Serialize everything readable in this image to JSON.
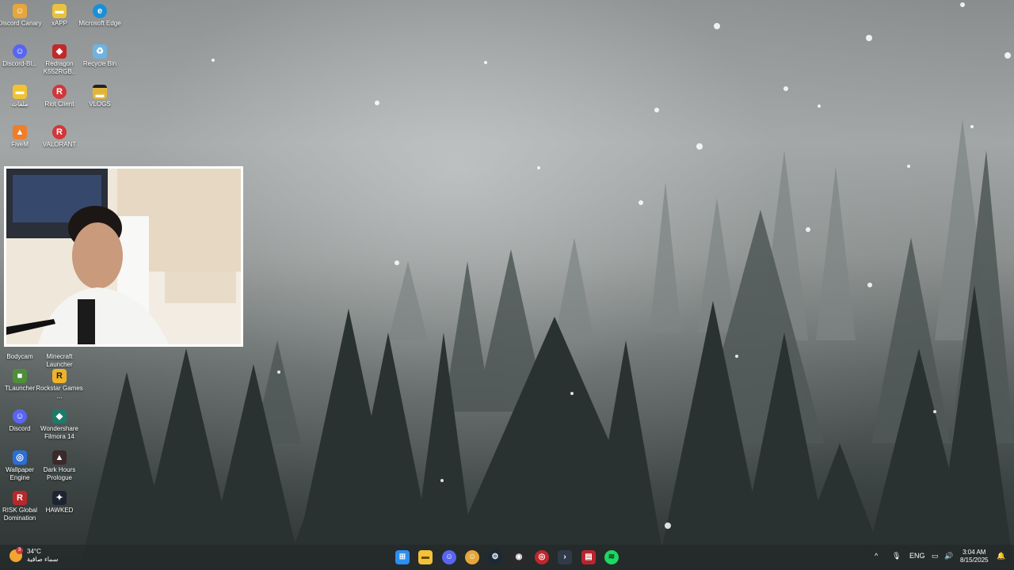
{
  "desktop": {
    "icons": [
      {
        "label": "Discord Canary",
        "icon": "discord-canary-icon",
        "color": "#e6a63a",
        "glyph": "☺"
      },
      {
        "label": "xAPP",
        "icon": "folder-icon",
        "color": "#e9c23d",
        "glyph": "▬"
      },
      {
        "label": "Microsoft Edge",
        "icon": "edge-icon",
        "color": "#1a8fd6",
        "glyph": "e"
      },
      {
        "label": "Discord-Bl...",
        "icon": "discord-icon",
        "color": "#5865f2",
        "glyph": "☺"
      },
      {
        "label": "Redragon K552RGB..",
        "icon": "redragon-icon",
        "color": "#c02a2a",
        "glyph": "◆"
      },
      {
        "label": "Recycle Bin",
        "icon": "recycle-bin-icon",
        "color": "#6fb3e0",
        "glyph": "♻"
      },
      {
        "label": "ملفات",
        "icon": "folder-icon",
        "color": "#f1c232",
        "glyph": "▬"
      },
      {
        "label": "Riot Client",
        "icon": "riot-client-icon",
        "color": "#d1363a",
        "glyph": "R"
      },
      {
        "label": "VLOGS",
        "icon": "vlogs-folder-icon",
        "color": "#e2b43a",
        "glyph": "▬"
      },
      {
        "label": "FiveM",
        "icon": "fivem-icon",
        "color": "#f07d2a",
        "glyph": "▲"
      },
      {
        "label": "VALORANT",
        "icon": "valorant-icon",
        "color": "#d1363a",
        "glyph": "R"
      },
      {
        "label": "Bodycam",
        "icon": "bodycam-icon",
        "color": "#444444",
        "glyph": ""
      },
      {
        "label": "Minecraft Launcher",
        "icon": "minecraft-launcher-icon",
        "color": "#5c8a3a",
        "glyph": ""
      },
      {
        "label": "TLauncher",
        "icon": "tlauncher-icon",
        "color": "#4f8f3a",
        "glyph": "■"
      },
      {
        "label": "Rockstar Games ...",
        "icon": "rockstar-icon",
        "color": "#f0b429",
        "glyph": "R"
      },
      {
        "label": "Discord",
        "icon": "discord-icon",
        "color": "#5865f2",
        "glyph": "☺"
      },
      {
        "label": "Wondershare Filmora 14",
        "icon": "filmora-icon",
        "color": "#1f7a6a",
        "glyph": "◆"
      },
      {
        "label": "Wallpaper Engine",
        "icon": "wallpaper-engine-icon",
        "color": "#2a6fd6",
        "glyph": "◎"
      },
      {
        "label": "Dark Hours Prologue",
        "icon": "dark-hours-icon",
        "color": "#3a2a2a",
        "glyph": "▲"
      },
      {
        "label": "RISK Global Domination",
        "icon": "risk-icon",
        "color": "#b8282b",
        "glyph": "R"
      },
      {
        "label": "HAWKED",
        "icon": "hawked-icon",
        "color": "#1d2430",
        "glyph": "✦"
      }
    ]
  },
  "webcam": {
    "icon": "webcam-overlay"
  },
  "taskbar": {
    "weather": {
      "temp": "34°C",
      "desc": "سماء صافية",
      "badge": "3",
      "icon": "weather-sun-icon"
    },
    "apps": [
      {
        "name": "start-icon",
        "color": "#2b8ef0",
        "glyph": "⊞"
      },
      {
        "name": "file-explorer-icon",
        "color": "#f3c13a",
        "glyph": "▬"
      },
      {
        "name": "discord-icon",
        "color": "#5865f2",
        "glyph": "☺"
      },
      {
        "name": "discord-canary-icon",
        "color": "#e6a63a",
        "glyph": "☺"
      },
      {
        "name": "steam-icon",
        "color": "#1b2838",
        "glyph": "⚙"
      },
      {
        "name": "obs-icon",
        "color": "#2a2a2a",
        "glyph": "◉"
      },
      {
        "name": "riot-vanguard-icon",
        "color": "#c0262d",
        "glyph": "◎"
      },
      {
        "name": "terminal-icon",
        "color": "#2f3b48",
        "glyph": "›"
      },
      {
        "name": "capcut-icon",
        "color": "#b7252b",
        "glyph": "▤"
      },
      {
        "name": "spotify-icon",
        "color": "#1ed760",
        "glyph": "≋"
      }
    ],
    "tray": {
      "chevron": "^",
      "language": "ENG"
    },
    "clock": {
      "time": "3:04 AM",
      "date": "8/15/2025"
    }
  }
}
